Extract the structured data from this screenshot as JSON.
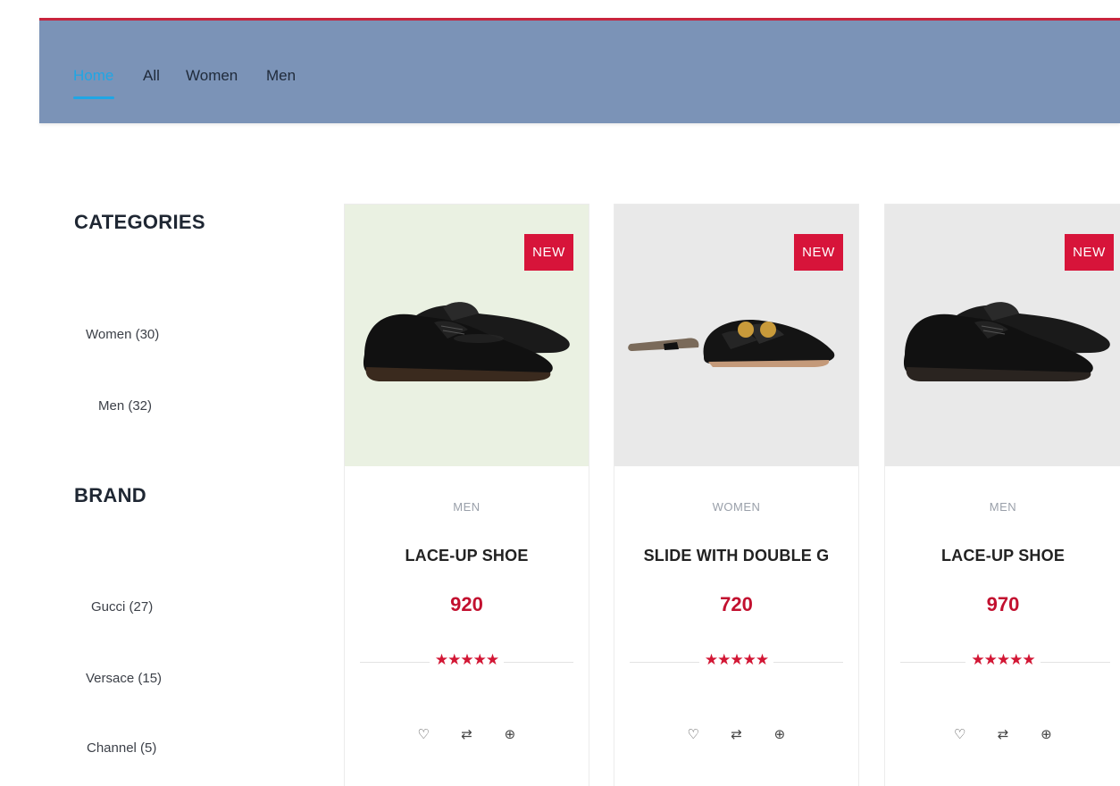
{
  "nav": {
    "items": [
      {
        "label": "Home",
        "active": true
      },
      {
        "label": "All",
        "active": false
      },
      {
        "label": "Women",
        "active": false
      },
      {
        "label": "Men",
        "active": false
      }
    ],
    "bar_color": "#7b93b7",
    "active_color": "#1fa6e5"
  },
  "sidebar": {
    "categories_title": "CATEGORIES",
    "categories": [
      {
        "label": "Women (30)"
      },
      {
        "label": "Men (32)"
      }
    ],
    "brand_title": "BRAND",
    "brands": [
      {
        "label": "Gucci (27)"
      },
      {
        "label": "Versace (15)"
      },
      {
        "label": "Channel (5)"
      }
    ]
  },
  "products": [
    {
      "badge": "NEW",
      "category": "MEN",
      "name": "LACE-UP SHOE",
      "price": "920",
      "stars": "★★★★★",
      "rating": 5,
      "image": "black-oxford-shoe",
      "bg": "#eaf1e2"
    },
    {
      "badge": "NEW",
      "category": "WOMEN",
      "name": "SLIDE WITH DOUBLE G",
      "price": "720",
      "stars": "★★★★★",
      "rating": 5,
      "image": "black-leather-slide-sandal",
      "bg": "#e9e9e9"
    },
    {
      "badge": "NEW",
      "category": "MEN",
      "name": "LACE-UP SHOE",
      "price": "970",
      "stars": "★★★★★",
      "rating": 5,
      "image": "black-oxford-shoe",
      "bg": "#e9e9e9"
    }
  ],
  "actions": {
    "wishlist": "♡",
    "compare": "⇄",
    "view": "⊕"
  },
  "colors": {
    "accent": "#d7143a",
    "price": "#c2102f"
  }
}
